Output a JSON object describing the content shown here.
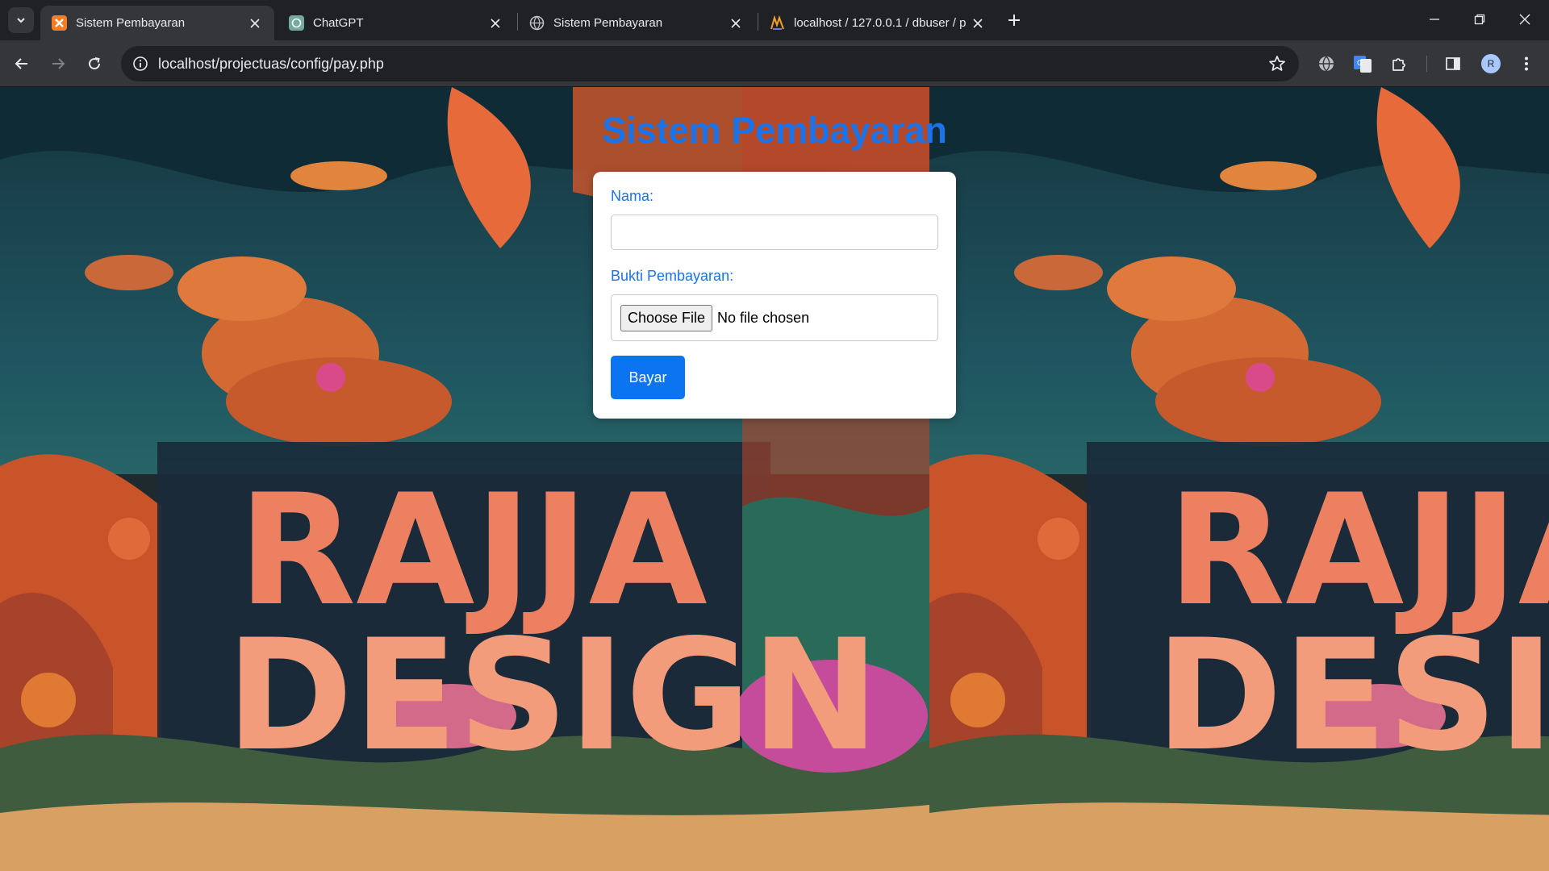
{
  "browser": {
    "tabs": [
      {
        "title": "Sistem Pembayaran",
        "active": true,
        "favicon": "xampp-icon"
      },
      {
        "title": "ChatGPT",
        "active": false,
        "favicon": "chatgpt-icon"
      },
      {
        "title": "Sistem Pembayaran",
        "active": false,
        "favicon": "globe-icon"
      },
      {
        "title": "localhost / 127.0.0.1 / dbuser / p",
        "active": false,
        "favicon": "phpmyadmin-icon"
      }
    ],
    "address_url": "localhost/projectuas/config/pay.php",
    "profile_initial": "R"
  },
  "page": {
    "heading": "Sistem Pembayaran",
    "form": {
      "name_label": "Nama:",
      "name_value": "",
      "proof_label": "Bukti Pembayaran:",
      "choose_file_label": "Choose File",
      "file_status": "No file chosen",
      "submit_label": "Bayar"
    },
    "background_poster_text": [
      "RAJJA",
      "DESIGN"
    ]
  },
  "colors": {
    "accent": "#1a73e8",
    "button": "#0b74f0",
    "chrome_bg": "#202124",
    "toolbar_bg": "#35363a"
  }
}
